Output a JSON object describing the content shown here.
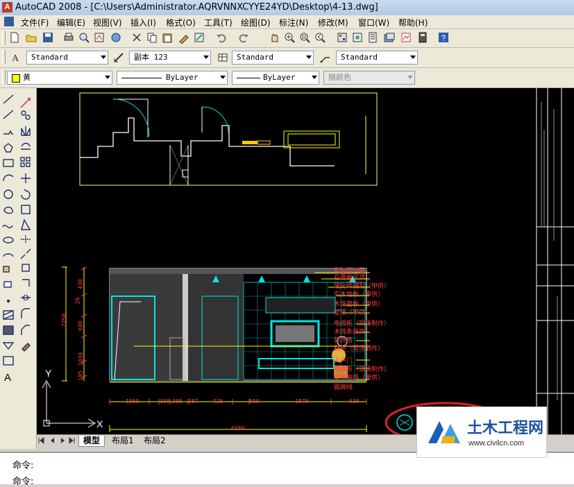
{
  "window": {
    "title": "AutoCAD 2008 - [C:\\Users\\Administrator.AQRVNNXCYYE24YD\\Desktop\\4-13.dwg]"
  },
  "menu": [
    "文件(F)",
    "编辑(E)",
    "视图(V)",
    "插入(I)",
    "格式(O)",
    "工具(T)",
    "绘图(D)",
    "标注(N)",
    "修改(M)",
    "窗口(W)",
    "帮助(H)"
  ],
  "styles_toolbar": {
    "text_style": "Standard",
    "dim_style": "副本 123",
    "table_style": "Standard",
    "multileader_style": "Standard"
  },
  "layers_toolbar": {
    "color": "黄",
    "linetype": "ByLayer",
    "lineweight": "ByLayer",
    "plot_style": "随颜色"
  },
  "layout_tabs": [
    "模型",
    "布局1",
    "布局2"
  ],
  "command_lines": [
    "命令:",
    "命令:"
  ],
  "drawing": {
    "annotations": [
      "乳胶漆饰面",
      "石膏板吊顶",
      "玻化砖铺贴（甲供）",
      "实木地板（甲供）",
      "木饰面板（甲供）",
      "壁纸（甲供）",
      "电视柜（现场制作）",
      "木线条装饰",
      "装饰画",
      "鞋柜（现场制作）",
      "入户门",
      "电视柜（现场制作）",
      "壁纸装饰（甲供）",
      "踢脚线"
    ],
    "dims_bottom": [
      "1000",
      "300",
      "300",
      "387",
      "925",
      "500",
      "1870",
      "630"
    ],
    "dim_total": "6180",
    "dims_left": [
      "2750",
      "20",
      "430",
      "680",
      "1030",
      "105"
    ],
    "axis_x": "X",
    "axis_y": "Y"
  },
  "watermark": {
    "title": "土木工程网",
    "url": "www.civilcn.com"
  },
  "colors": {
    "drawing_bg": "#000000",
    "cyan": "#00e5e5",
    "yellow": "#ffff00",
    "highlight": "#e02020"
  }
}
